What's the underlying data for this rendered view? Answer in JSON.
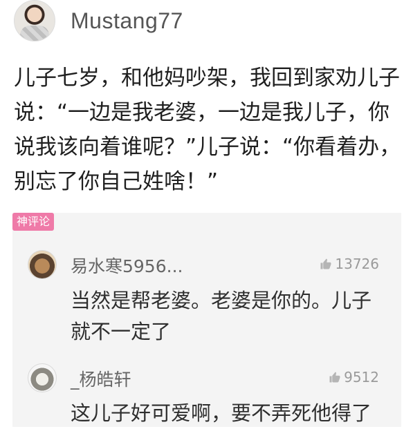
{
  "header": {
    "username": "Mustang77"
  },
  "post": {
    "text": "儿子七岁，和他妈吵架，我回到家劝儿子说：“一边是我老婆，一边是我儿子，你说我该向着谁呢？”儿子说：“你看着办，别忘了你自己姓啥！”"
  },
  "hot_comments": {
    "badge": "神评论",
    "items": [
      {
        "name": "易水寒5956...",
        "likes": "13726",
        "text": "当然是帮老婆。老婆是你的。儿子就不一定了"
      },
      {
        "name": "_杨皓轩",
        "likes": "9512",
        "text": "这儿子好可爱啊，要不弄死他得了"
      }
    ]
  },
  "colors": {
    "badge_bg": "#ef7aa8",
    "comment_bg": "#f4f4f4",
    "muted": "#9a9a9a"
  },
  "icons": {
    "like": "thumbs-up-icon"
  }
}
